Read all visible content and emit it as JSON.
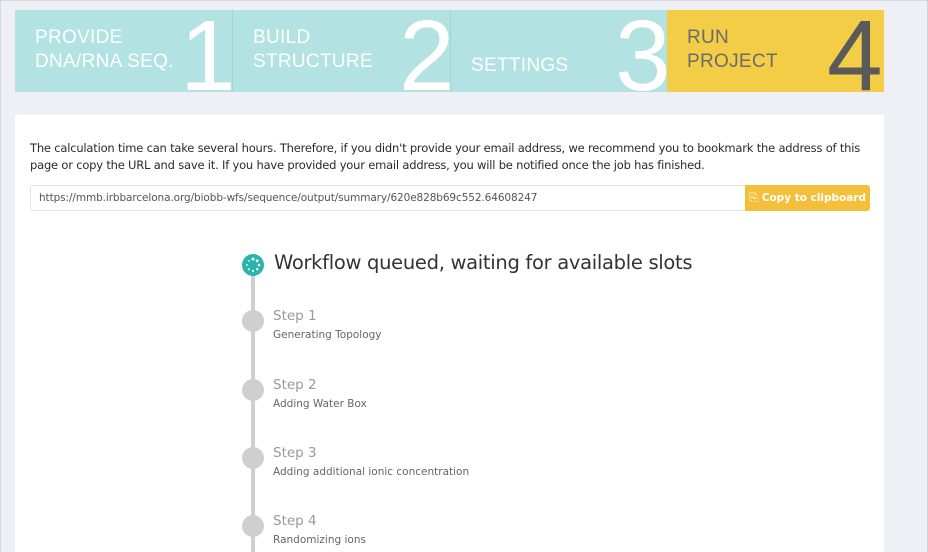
{
  "stepper": {
    "steps": [
      {
        "label": "PROVIDE DNA/RNA SEQ.",
        "line1": "PROVIDE",
        "line2": "DNA/RNA SEQ.",
        "number": "1"
      },
      {
        "label": "BUILD STRUCTURE",
        "line1": "BUILD",
        "line2": "STRUCTURE",
        "number": "2"
      },
      {
        "label": "SETTINGS",
        "line1": "SETTINGS",
        "number": "3"
      },
      {
        "label": "RUN PROJECT",
        "line1": "RUN",
        "line2": "PROJECT",
        "number": "4",
        "active": true
      }
    ]
  },
  "info": {
    "text": "The calculation time can take several hours. Therefore, if you didn't provide your email address, we recommend you to bookmark the address of this page or copy the URL and save it. If you have provided your email address, you will be notified once the job has finished."
  },
  "url_field": {
    "value": "https://mmb.irbbarcelona.org/biobb-wfs/sequence/output/summary/620e828b69c552.64608247",
    "copy_label": "Copy to clipboard",
    "copy_icon": "copy-icon"
  },
  "workflow": {
    "status": "Workflow queued, waiting for available slots",
    "status_icon": "spinner-icon",
    "steps": [
      {
        "title": "Step 1",
        "description": "Generating Topology"
      },
      {
        "title": "Step 2",
        "description": "Adding Water Box"
      },
      {
        "title": "Step 3",
        "description": "Adding additional ionic concentration"
      },
      {
        "title": "Step 4",
        "description": "Randomizing ions"
      }
    ]
  },
  "colors": {
    "stepper_inactive": "#b3e2e3",
    "stepper_active": "#f4cd47",
    "copy_button": "#f4bf3a",
    "queued_dot": "#2bb3ad",
    "pending_dot": "#cfcfcf"
  }
}
